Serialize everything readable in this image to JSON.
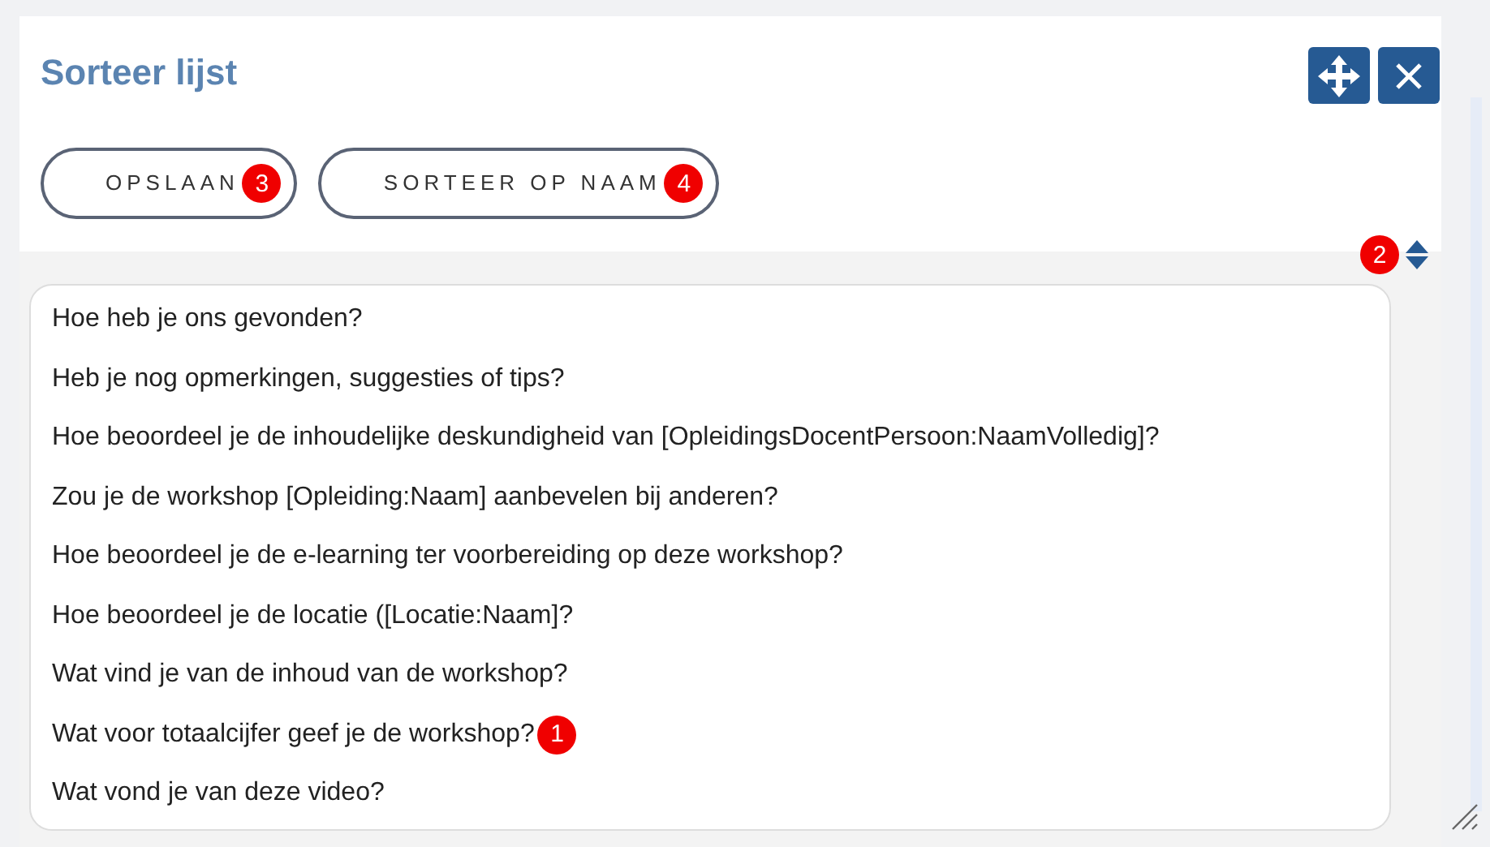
{
  "dialog": {
    "title": "Sorteer lijst"
  },
  "buttons": [
    {
      "label": "OPSLAAN",
      "badge": "3"
    },
    {
      "label": "SORTEER OP NAAM",
      "badge": "4"
    }
  ],
  "sort_control": {
    "badge": "2"
  },
  "items": [
    {
      "text": "Hoe heb je ons gevonden?"
    },
    {
      "text": "Heb je nog opmerkingen, suggesties of tips?"
    },
    {
      "text": "Hoe beoordeel je de inhoudelijke deskundigheid van [OpleidingsDocentPersoon:NaamVolledig]?"
    },
    {
      "text": "Zou je de workshop [Opleiding:Naam] aanbevelen bij anderen?"
    },
    {
      "text": "Hoe beoordeel je de e-learning ter voorbereiding op deze workshop?"
    },
    {
      "text": "Hoe beoordeel je de locatie ([Locatie:Naam]?"
    },
    {
      "text": "Wat vind je van de inhoud van de workshop?"
    },
    {
      "text": "Wat voor totaalcijfer geef je de workshop?",
      "badge": "1"
    },
    {
      "text": "Wat vond je van deze video?"
    }
  ]
}
